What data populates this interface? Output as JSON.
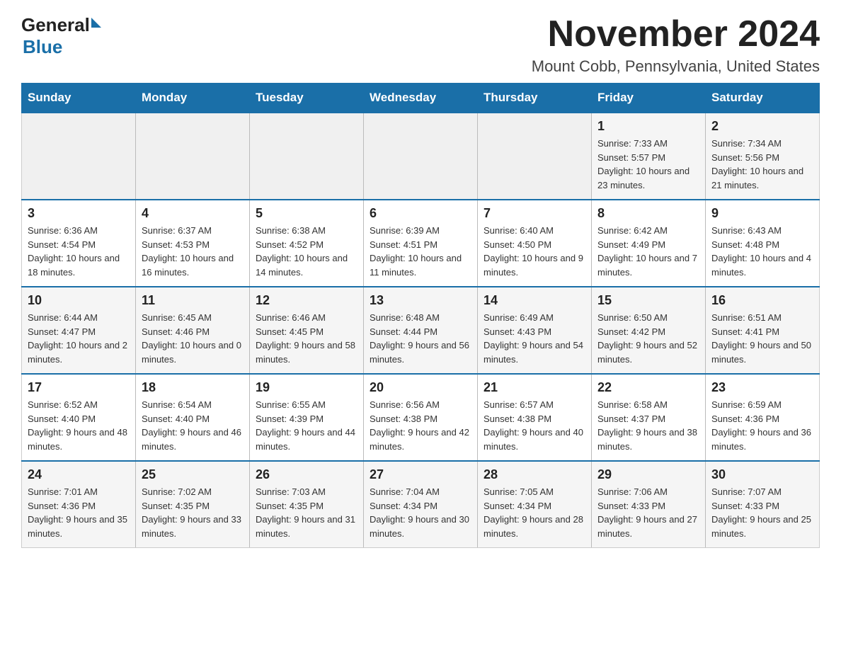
{
  "header": {
    "logo_general": "General",
    "logo_blue": "Blue",
    "month_title": "November 2024",
    "location": "Mount Cobb, Pennsylvania, United States"
  },
  "calendar": {
    "days_of_week": [
      "Sunday",
      "Monday",
      "Tuesday",
      "Wednesday",
      "Thursday",
      "Friday",
      "Saturday"
    ],
    "weeks": [
      [
        {
          "day": "",
          "info": ""
        },
        {
          "day": "",
          "info": ""
        },
        {
          "day": "",
          "info": ""
        },
        {
          "day": "",
          "info": ""
        },
        {
          "day": "",
          "info": ""
        },
        {
          "day": "1",
          "info": "Sunrise: 7:33 AM\nSunset: 5:57 PM\nDaylight: 10 hours and 23 minutes."
        },
        {
          "day": "2",
          "info": "Sunrise: 7:34 AM\nSunset: 5:56 PM\nDaylight: 10 hours and 21 minutes."
        }
      ],
      [
        {
          "day": "3",
          "info": "Sunrise: 6:36 AM\nSunset: 4:54 PM\nDaylight: 10 hours and 18 minutes."
        },
        {
          "day": "4",
          "info": "Sunrise: 6:37 AM\nSunset: 4:53 PM\nDaylight: 10 hours and 16 minutes."
        },
        {
          "day": "5",
          "info": "Sunrise: 6:38 AM\nSunset: 4:52 PM\nDaylight: 10 hours and 14 minutes."
        },
        {
          "day": "6",
          "info": "Sunrise: 6:39 AM\nSunset: 4:51 PM\nDaylight: 10 hours and 11 minutes."
        },
        {
          "day": "7",
          "info": "Sunrise: 6:40 AM\nSunset: 4:50 PM\nDaylight: 10 hours and 9 minutes."
        },
        {
          "day": "8",
          "info": "Sunrise: 6:42 AM\nSunset: 4:49 PM\nDaylight: 10 hours and 7 minutes."
        },
        {
          "day": "9",
          "info": "Sunrise: 6:43 AM\nSunset: 4:48 PM\nDaylight: 10 hours and 4 minutes."
        }
      ],
      [
        {
          "day": "10",
          "info": "Sunrise: 6:44 AM\nSunset: 4:47 PM\nDaylight: 10 hours and 2 minutes."
        },
        {
          "day": "11",
          "info": "Sunrise: 6:45 AM\nSunset: 4:46 PM\nDaylight: 10 hours and 0 minutes."
        },
        {
          "day": "12",
          "info": "Sunrise: 6:46 AM\nSunset: 4:45 PM\nDaylight: 9 hours and 58 minutes."
        },
        {
          "day": "13",
          "info": "Sunrise: 6:48 AM\nSunset: 4:44 PM\nDaylight: 9 hours and 56 minutes."
        },
        {
          "day": "14",
          "info": "Sunrise: 6:49 AM\nSunset: 4:43 PM\nDaylight: 9 hours and 54 minutes."
        },
        {
          "day": "15",
          "info": "Sunrise: 6:50 AM\nSunset: 4:42 PM\nDaylight: 9 hours and 52 minutes."
        },
        {
          "day": "16",
          "info": "Sunrise: 6:51 AM\nSunset: 4:41 PM\nDaylight: 9 hours and 50 minutes."
        }
      ],
      [
        {
          "day": "17",
          "info": "Sunrise: 6:52 AM\nSunset: 4:40 PM\nDaylight: 9 hours and 48 minutes."
        },
        {
          "day": "18",
          "info": "Sunrise: 6:54 AM\nSunset: 4:40 PM\nDaylight: 9 hours and 46 minutes."
        },
        {
          "day": "19",
          "info": "Sunrise: 6:55 AM\nSunset: 4:39 PM\nDaylight: 9 hours and 44 minutes."
        },
        {
          "day": "20",
          "info": "Sunrise: 6:56 AM\nSunset: 4:38 PM\nDaylight: 9 hours and 42 minutes."
        },
        {
          "day": "21",
          "info": "Sunrise: 6:57 AM\nSunset: 4:38 PM\nDaylight: 9 hours and 40 minutes."
        },
        {
          "day": "22",
          "info": "Sunrise: 6:58 AM\nSunset: 4:37 PM\nDaylight: 9 hours and 38 minutes."
        },
        {
          "day": "23",
          "info": "Sunrise: 6:59 AM\nSunset: 4:36 PM\nDaylight: 9 hours and 36 minutes."
        }
      ],
      [
        {
          "day": "24",
          "info": "Sunrise: 7:01 AM\nSunset: 4:36 PM\nDaylight: 9 hours and 35 minutes."
        },
        {
          "day": "25",
          "info": "Sunrise: 7:02 AM\nSunset: 4:35 PM\nDaylight: 9 hours and 33 minutes."
        },
        {
          "day": "26",
          "info": "Sunrise: 7:03 AM\nSunset: 4:35 PM\nDaylight: 9 hours and 31 minutes."
        },
        {
          "day": "27",
          "info": "Sunrise: 7:04 AM\nSunset: 4:34 PM\nDaylight: 9 hours and 30 minutes."
        },
        {
          "day": "28",
          "info": "Sunrise: 7:05 AM\nSunset: 4:34 PM\nDaylight: 9 hours and 28 minutes."
        },
        {
          "day": "29",
          "info": "Sunrise: 7:06 AM\nSunset: 4:33 PM\nDaylight: 9 hours and 27 minutes."
        },
        {
          "day": "30",
          "info": "Sunrise: 7:07 AM\nSunset: 4:33 PM\nDaylight: 9 hours and 25 minutes."
        }
      ]
    ]
  }
}
